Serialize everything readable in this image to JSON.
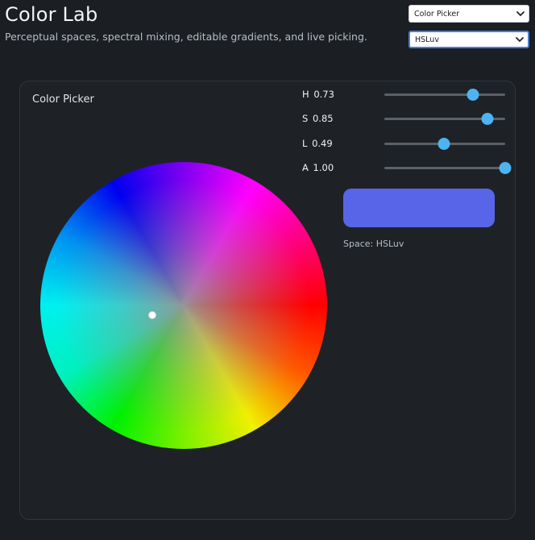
{
  "header": {
    "title": "Color Lab",
    "subtitle": "Perceptual spaces, spectral mixing, editable gradients, and live picking."
  },
  "view_select": {
    "value": "Color Picker"
  },
  "space_select": {
    "value": "HSLuv"
  },
  "panel": {
    "title": "Color Picker",
    "sliders": [
      {
        "label": "H",
        "value": "0.73",
        "fraction": 0.73
      },
      {
        "label": "S",
        "value": "0.85",
        "fraction": 0.85
      },
      {
        "label": "L",
        "value": "0.49",
        "fraction": 0.49
      },
      {
        "label": "A",
        "value": "1.00",
        "fraction": 1.0
      }
    ],
    "swatch_color": "#5865e8",
    "space_label": "Space: HSLuv"
  },
  "colors": {
    "accent": "#4db3f2",
    "background": "#1b1f23"
  }
}
